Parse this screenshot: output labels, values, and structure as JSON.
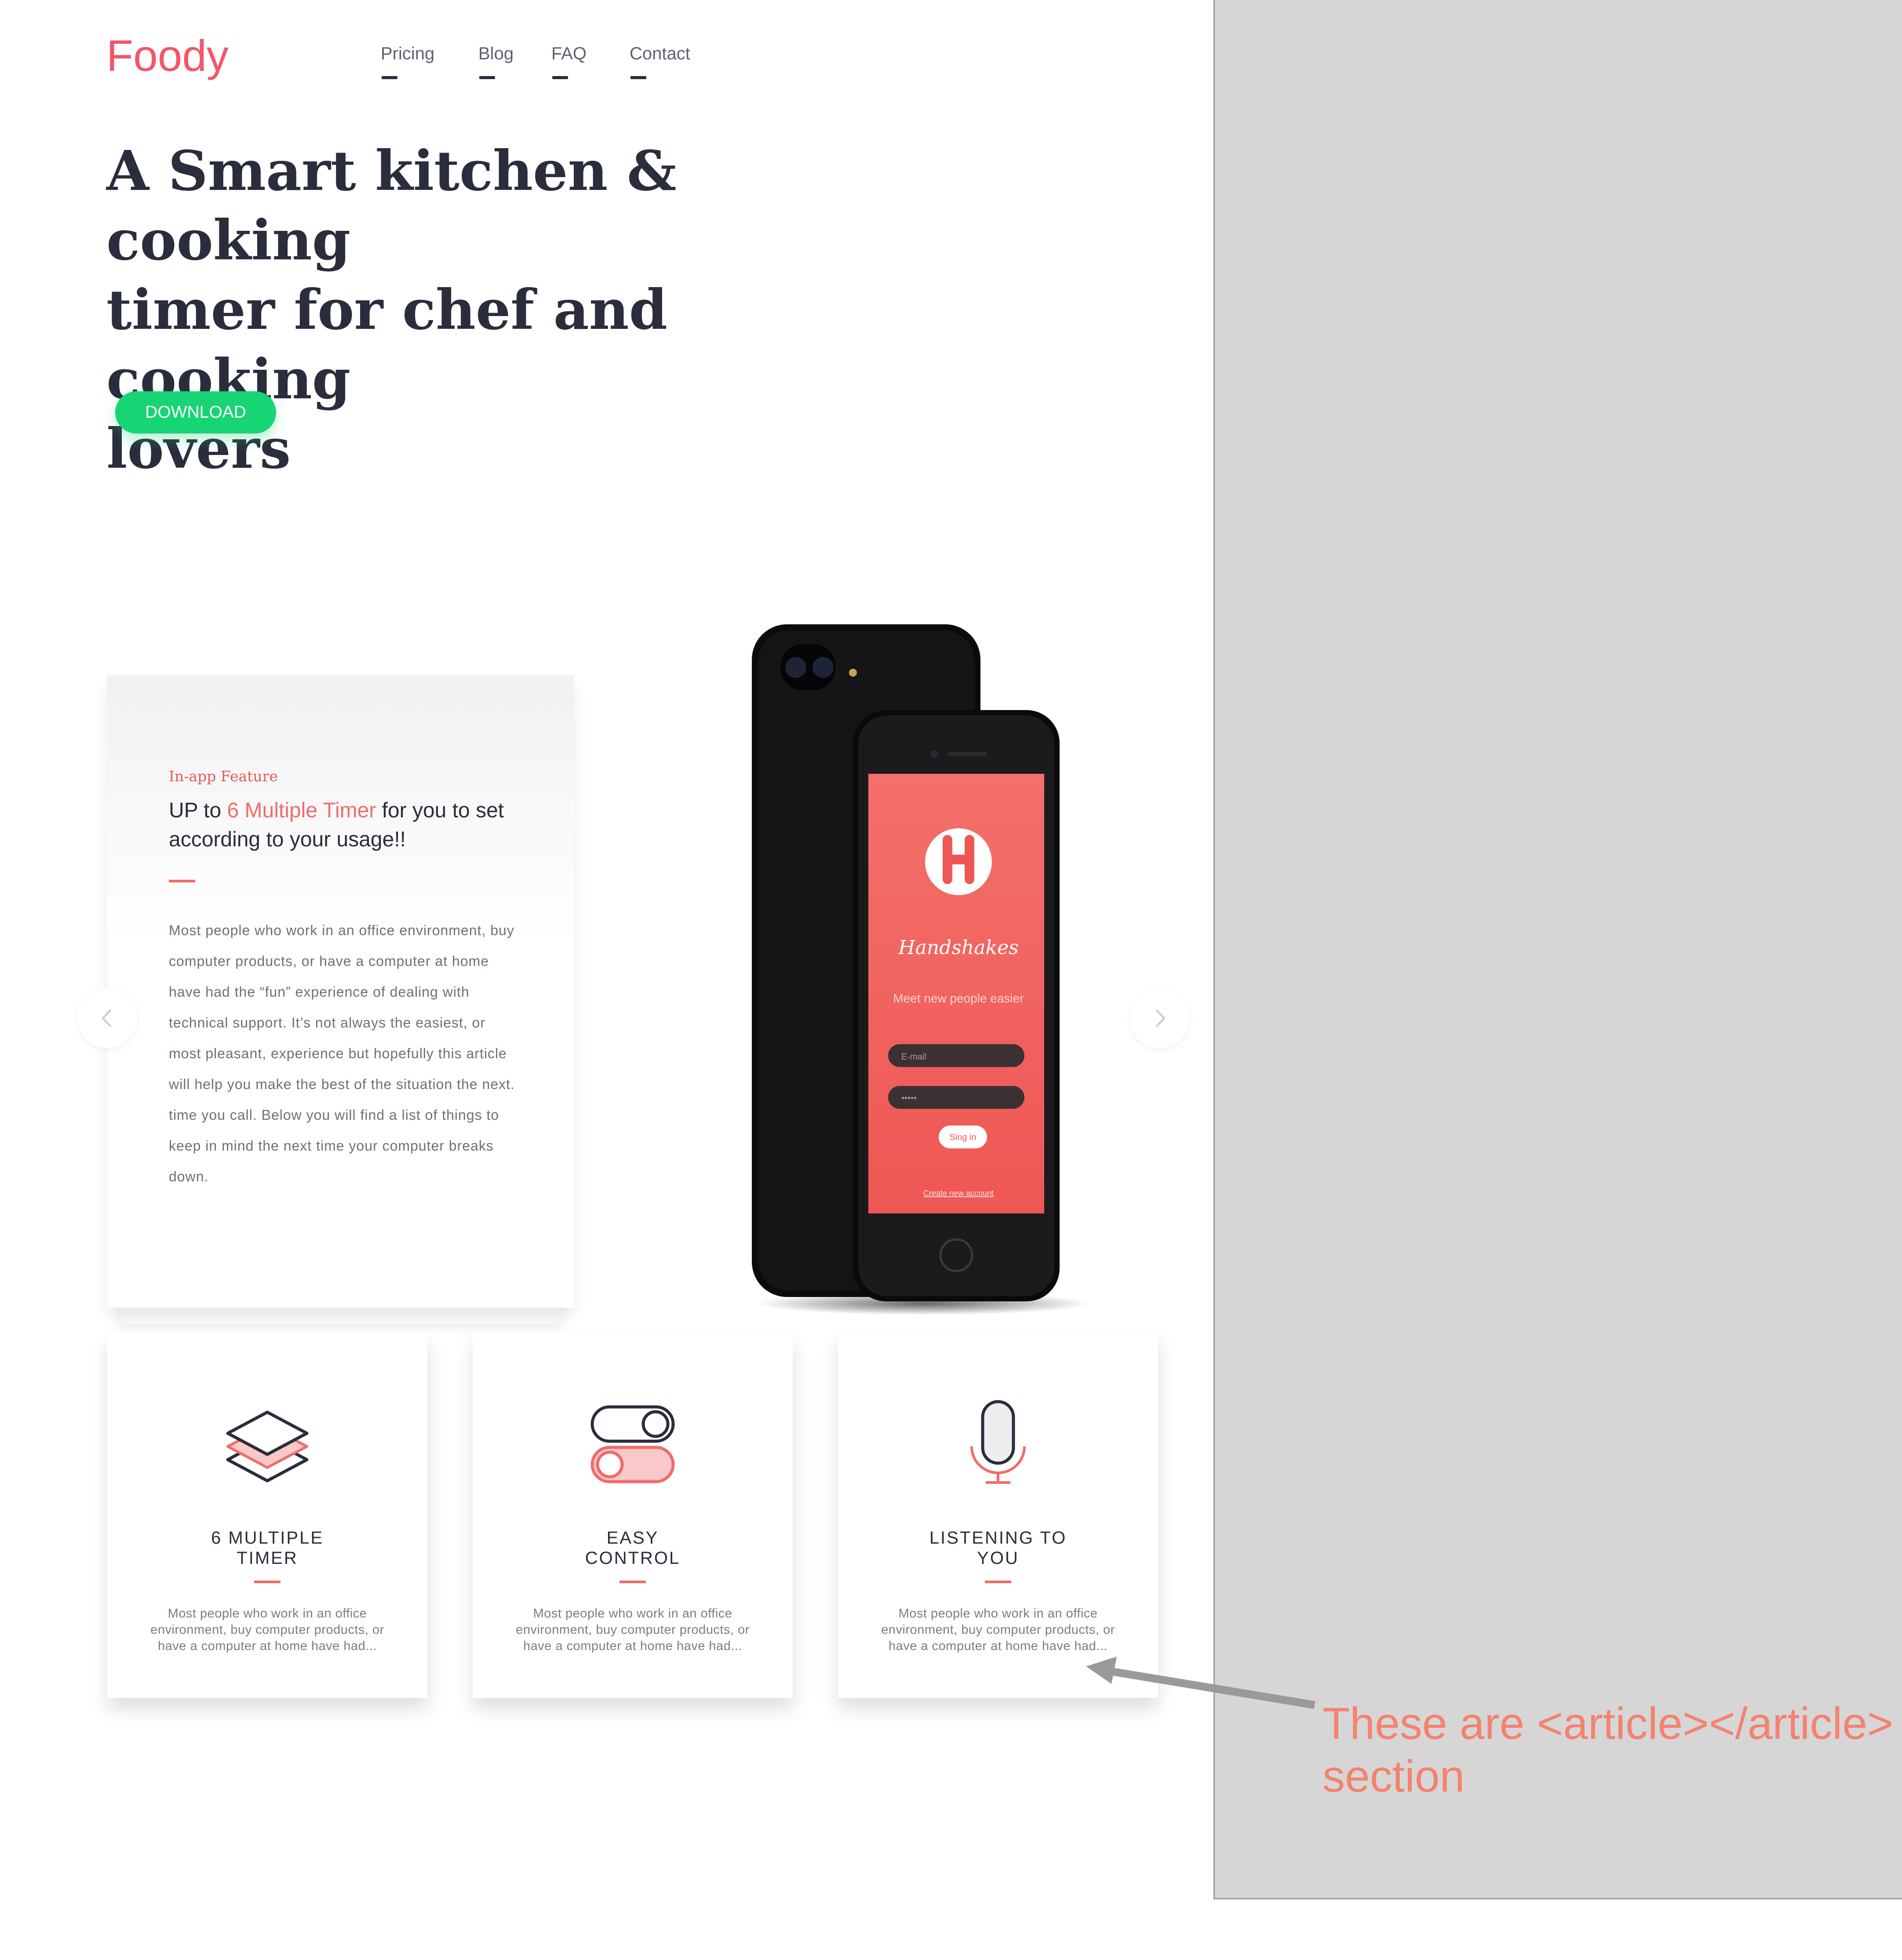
{
  "brand": {
    "name": "Foody",
    "accent": "#f2566b",
    "cta_color": "#17d475",
    "dark": "#2a2d3c"
  },
  "nav": {
    "items": [
      {
        "label": "Pricing"
      },
      {
        "label": "Blog"
      },
      {
        "label": "FAQ"
      },
      {
        "label": "Contact"
      }
    ]
  },
  "hero": {
    "line1": "A Smart kitchen & cooking",
    "line2": "timer for chef and cooking",
    "line3": "lovers",
    "cta_label": "DOWNLOAD"
  },
  "feature": {
    "kicker": "In-app Feature",
    "heading_pre": "UP to ",
    "heading_highlight": "6 Multiple Timer",
    "heading_post": " for you to set according to your usage!!",
    "body": "Most people who work in an office environment, buy computer products, or have a computer at home have had the “fun” experience of dealing with technical support. It’s not always the easiest, or most pleasant, experience but hopefully this article will help you make the best of the situation the next. time you call. Below you will find a list of things to keep in mind the next time your computer breaks down."
  },
  "phone": {
    "app_name": "Handshakes",
    "tagline": "Meet new people easier",
    "email_placeholder": "E-mail",
    "password_value": "•••••",
    "signin_label": "Sing in",
    "create_account_label": "Create new account"
  },
  "articles": [
    {
      "title": "6 MULTIPLE\nTIMER",
      "icon": "layers-icon",
      "desc": "Most people who work in an office environment, buy computer products, or have a computer at home have had..."
    },
    {
      "title": "EASY\nCONTROL",
      "icon": "toggle-icon",
      "desc": "Most people who work in an office environment, buy computer products, or have a computer at home have had..."
    },
    {
      "title": "LISTENING TO\nYOU",
      "icon": "microphone-icon",
      "desc": "Most people who work in an office environment, buy computer products, or have a computer at home have had..."
    }
  ],
  "annotation": {
    "line1": "These are <article></article>",
    "line2": "section",
    "color": "#f5826f"
  }
}
